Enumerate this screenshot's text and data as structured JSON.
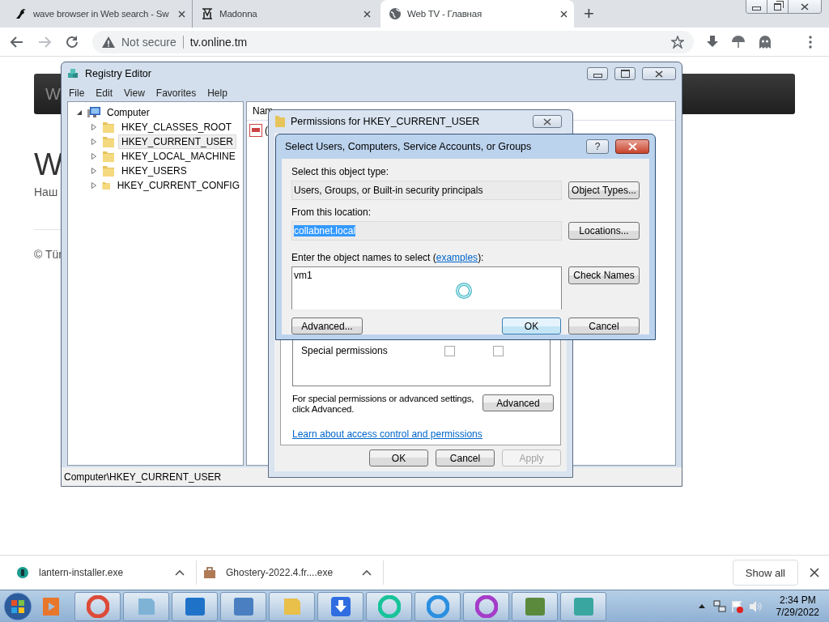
{
  "browser": {
    "tabs": [
      {
        "title": "wave browser in Web search - Sw",
        "selected": false
      },
      {
        "title": "Madonna",
        "selected": false
      },
      {
        "title": "Web TV - Главная",
        "selected": true
      }
    ],
    "new_tab": "+",
    "forward_disabled": true,
    "url_bar": {
      "security": "Not secure",
      "url": "tv.online.tm"
    }
  },
  "page": {
    "banner_text": "W",
    "heading": "W",
    "subtitle": "Наш",
    "footer": "© Tür"
  },
  "registry_editor": {
    "title": "Registry Editor",
    "menu": [
      "File",
      "Edit",
      "View",
      "Favorites",
      "Help"
    ],
    "tree": [
      {
        "label": "Computer",
        "expanded": true,
        "selected": false,
        "children": [
          {
            "label": "HKEY_CLASSES_ROOT",
            "expanded": false,
            "selected": false
          },
          {
            "label": "HKEY_CURRENT_USER",
            "expanded": false,
            "selected": true
          },
          {
            "label": "HKEY_LOCAL_MACHINE",
            "expanded": false,
            "selected": false
          },
          {
            "label": "HKEY_USERS",
            "expanded": false,
            "selected": false
          },
          {
            "label": "HKEY_CURRENT_CONFIG",
            "expanded": false,
            "selected": false
          }
        ]
      }
    ],
    "column_header": "Nam",
    "value_row": "(",
    "status_bar": "Computer\\HKEY_CURRENT_USER"
  },
  "permissions_dialog": {
    "title": "Permissions for HKEY_CURRENT_USER",
    "permission_rows": [
      {
        "name": "Special permissions",
        "allow": false,
        "deny": false
      }
    ],
    "advanced_note": "For special permissions or advanced settings, click Advanced.",
    "advanced_button": "Advanced",
    "link": "Learn about access control and permissions",
    "buttons": [
      {
        "label": "OK",
        "disabled": false
      },
      {
        "label": "Cancel",
        "disabled": false
      },
      {
        "label": "Apply",
        "disabled": true
      }
    ]
  },
  "select_dialog": {
    "title": "Select Users, Computers, Service Accounts, or Groups",
    "help_button": "?",
    "object_type_label": "Select this object type:",
    "object_type": "Users, Groups, or Built-in security principals",
    "object_types_button": "Object Types...",
    "location_label": "From this location:",
    "location": "collabnet.local",
    "location_selected": true,
    "locations_button": "Locations...",
    "names_label": "Enter the object names to select (",
    "names_link": "examples",
    "names_label_end": "):",
    "names_value": "vm1",
    "check_names_button": "Check Names",
    "busy": true,
    "advanced_button": "Advanced...",
    "ok_button": "OK",
    "cancel_button": "Cancel"
  },
  "downloads": [
    {
      "file": "lantern-installer.exe"
    },
    {
      "file": "Ghostery-2022.4.fr....exe"
    }
  ],
  "show_all": "Show all",
  "taskbar": {
    "time": "2:34 PM",
    "date": "7/29/2022"
  }
}
